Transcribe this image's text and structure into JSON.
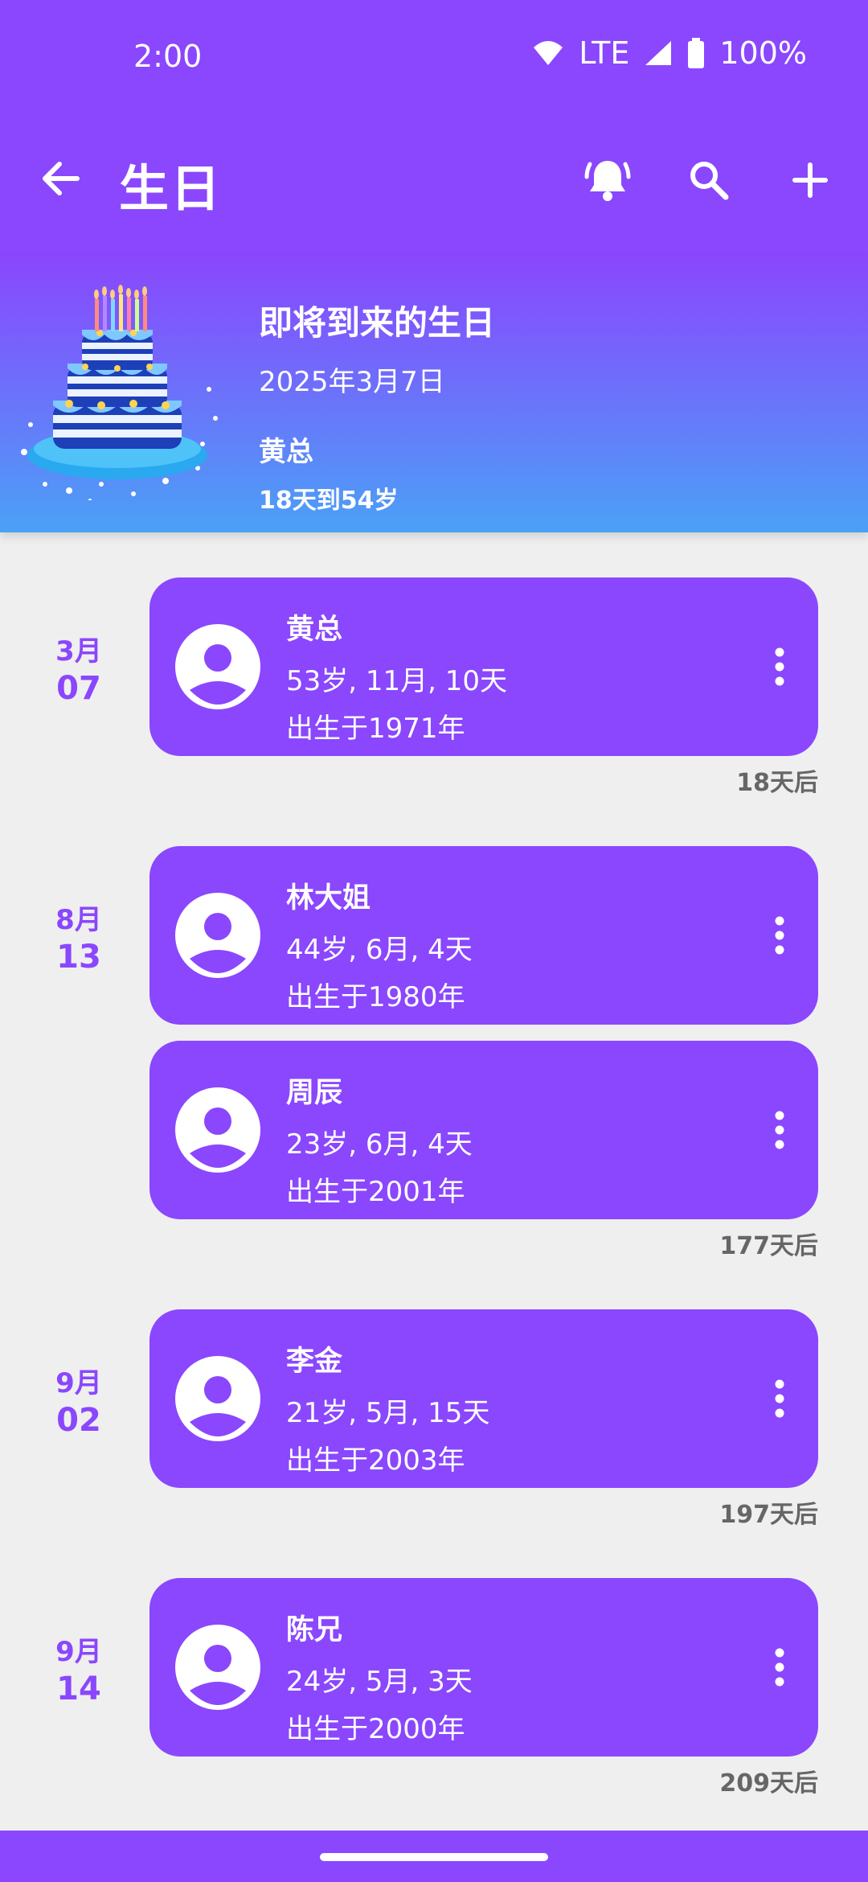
{
  "status_bar": {
    "time": "2:00",
    "network": "LTE",
    "battery": "100%"
  },
  "app_bar": {
    "title": "生日",
    "icons": [
      "back-arrow-icon",
      "alarm-bell-icon",
      "search-icon",
      "add-icon"
    ]
  },
  "banner": {
    "heading": "即将到来的生日",
    "date": "2025年3月7日",
    "name": "黄总",
    "until": "18天到54岁",
    "image": "birthday-cake"
  },
  "groups": [
    {
      "month": "3月",
      "day": "07",
      "countdown": "18天后",
      "people": [
        {
          "name": "黄总",
          "age": "53岁, 11月, 10天",
          "born": "出生于1971年"
        }
      ]
    },
    {
      "month": "8月",
      "day": "13",
      "countdown": "177天后",
      "people": [
        {
          "name": "林大姐",
          "age": "44岁, 6月, 4天",
          "born": "出生于1980年"
        },
        {
          "name": "周辰",
          "age": "23岁, 6月, 4天",
          "born": "出生于2001年"
        }
      ]
    },
    {
      "month": "9月",
      "day": "02",
      "countdown": "197天后",
      "people": [
        {
          "name": "李金",
          "age": "21岁, 5月, 15天",
          "born": "出生于2003年"
        }
      ]
    },
    {
      "month": "9月",
      "day": "14",
      "countdown": "209天后",
      "people": [
        {
          "name": "陈兄",
          "age": "24岁, 5月, 3天",
          "born": "出生于2000年"
        }
      ]
    }
  ],
  "colors": {
    "primary": "#8a47fd",
    "gradient_end": "#4aa1f6",
    "background": "#efefef",
    "countdown_text": "#666666"
  }
}
